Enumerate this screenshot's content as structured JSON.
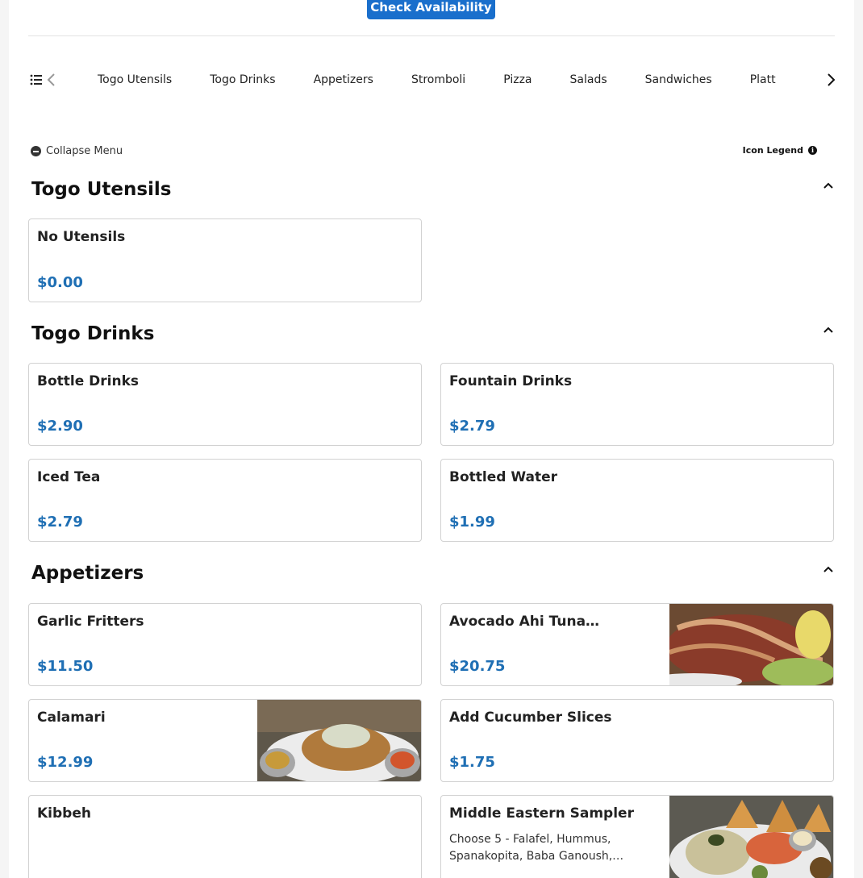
{
  "header": {
    "check_availability_label": "Check Availability"
  },
  "categories": [
    "Togo Utensils",
    "Togo Drinks",
    "Appetizers",
    "Stromboli",
    "Pizza",
    "Salads",
    "Sandwiches",
    "Platt"
  ],
  "menu_controls": {
    "collapse_label": "Collapse Menu",
    "legend_label": "Icon Legend"
  },
  "sections": [
    {
      "title": "Togo Utensils",
      "items": [
        {
          "name": "No Utensils",
          "price": "$0.00"
        }
      ]
    },
    {
      "title": "Togo Drinks",
      "items": [
        {
          "name": "Bottle Drinks",
          "price": "$2.90"
        },
        {
          "name": "Fountain Drinks",
          "price": "$2.79"
        },
        {
          "name": "Iced Tea",
          "price": "$2.79"
        },
        {
          "name": "Bottled Water",
          "price": "$1.99"
        }
      ]
    },
    {
      "title": "Appetizers",
      "items": [
        {
          "name": "Garlic Fritters",
          "price": "$11.50"
        },
        {
          "name": "Avocado Ahi Tuna…",
          "price": "$20.75"
        },
        {
          "name": "Calamari",
          "price": "$12.99"
        },
        {
          "name": "Add Cucumber Slices",
          "price": "$1.75"
        },
        {
          "name": "Kibbeh"
        },
        {
          "name": "Middle Eastern Sampler",
          "description": "Choose 5 - Falafel, Hummus, Spanakopita, Baba Ganoush,…"
        }
      ]
    }
  ],
  "colors": {
    "accent": "#1a6fcc",
    "price": "#1f6fb4",
    "border": "#d2d2d2"
  }
}
